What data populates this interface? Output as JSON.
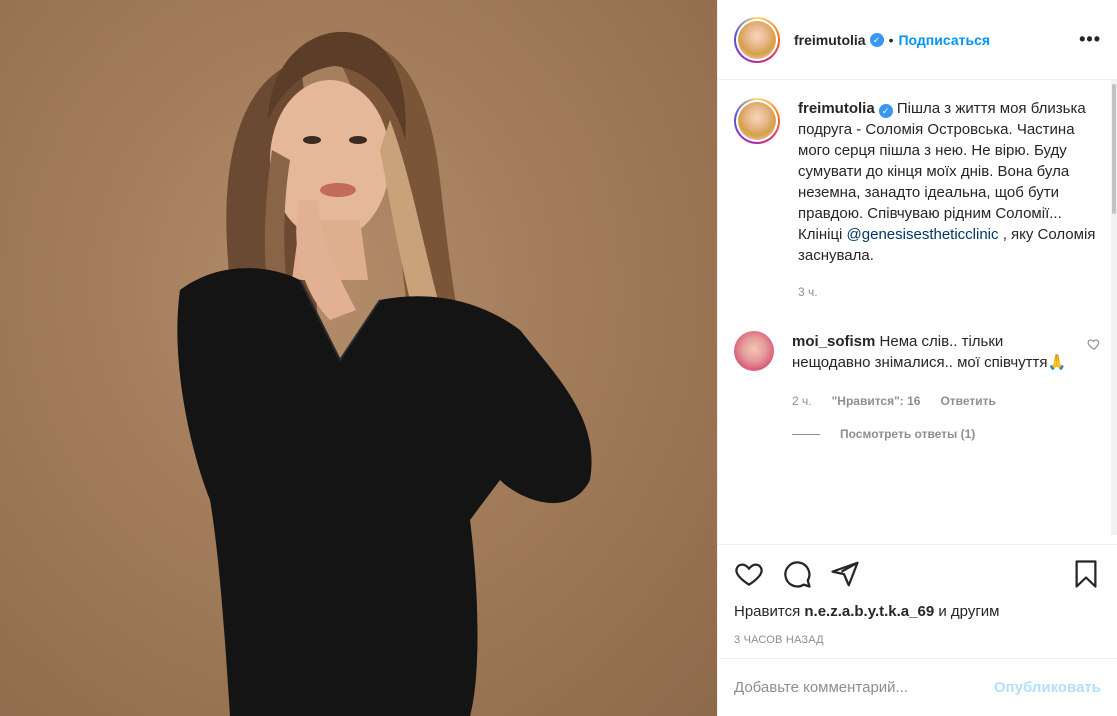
{
  "post": {
    "author": "freimutolia",
    "follow_label": "Подписаться",
    "dot": "•",
    "more_label": "•••",
    "verified_glyph": "✓"
  },
  "caption": {
    "author": "freimutolia",
    "text_before_mention": "Пішла з життя моя близька подруга - Соломія Островська. Частина мого серця пішла з нею. Не вірю. Буду сумувати до кінця моїх днів. Вона була неземна, занадто ідеальна, щоб бути правдою. Співчуваю рідним Соломії... Клініці",
    "mention": "@genesisestheticclinic",
    "text_after_mention": ", яку Соломія заснувала.",
    "time": "3 ч."
  },
  "comment": {
    "author": "moi_sofism",
    "text": "Нема слів.. тільки нещодавно знімалися.. мої співчуття🙏",
    "time": "2 ч.",
    "likes_label": "\"Нравится\": 16",
    "reply_label": "Ответить",
    "view_replies": "Посмотреть ответы (1)"
  },
  "likes": {
    "prefix": "Нравится",
    "user": "n.e.z.a.b.y.t.k.a_69",
    "suffix": "и другим"
  },
  "posted_ago": "3 ЧАСОВ НАЗАД",
  "add_comment": {
    "placeholder": "Добавьте комментарий...",
    "publish_label": "Опубликовать"
  },
  "icons": {
    "like": "heart-icon",
    "comment": "comment-icon",
    "share": "paper-plane-icon",
    "save": "bookmark-icon"
  },
  "colors": {
    "link": "#0095f6",
    "mention": "#00376b",
    "muted": "#8e8e8e",
    "publish_disabled": "#b2dffc",
    "photo_background": "#a27c5a"
  }
}
